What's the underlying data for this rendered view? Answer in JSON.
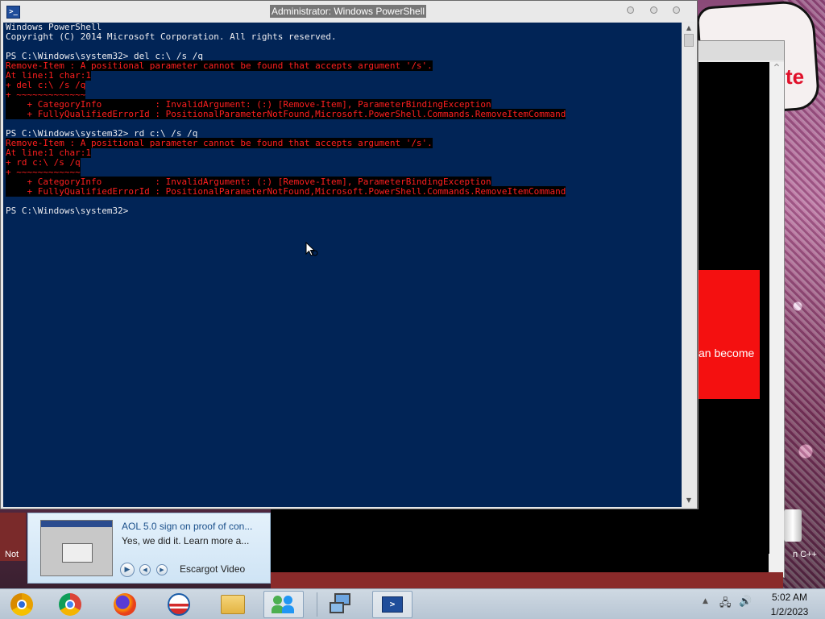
{
  "window": {
    "title": "Administrator: Windows PowerShell",
    "app_icon_glyph": ">_"
  },
  "console": {
    "lines": [
      {
        "text": "Windows PowerShell",
        "error": false
      },
      {
        "text": "Copyright (C) 2014 Microsoft Corporation. All rights reserved.",
        "error": false
      },
      {
        "text": "",
        "error": false
      },
      {
        "text": "PS C:\\Windows\\system32> del c:\\ /s /q",
        "error": false
      },
      {
        "text": "Remove-Item : A positional parameter cannot be found that accepts argument '/s'.",
        "error": true
      },
      {
        "text": "At line:1 char:1",
        "error": true
      },
      {
        "text": "+ del c:\\ /s /q",
        "error": true
      },
      {
        "text": "+ ~~~~~~~~~~~~~",
        "error": true
      },
      {
        "text": "    + CategoryInfo          : InvalidArgument: (:) [Remove-Item], ParameterBindingException",
        "error": true
      },
      {
        "text": "    + FullyQualifiedErrorId : PositionalParameterNotFound,Microsoft.PowerShell.Commands.RemoveItemCommand",
        "error": true
      },
      {
        "text": "",
        "error": false
      },
      {
        "text": "PS C:\\Windows\\system32> rd c:\\ /s /q",
        "error": false
      },
      {
        "text": "Remove-Item : A positional parameter cannot be found that accepts argument '/s'.",
        "error": true
      },
      {
        "text": "At line:1 char:1",
        "error": true
      },
      {
        "text": "+ rd c:\\ /s /q",
        "error": true
      },
      {
        "text": "+ ~~~~~~~~~~~~",
        "error": true
      },
      {
        "text": "    + CategoryInfo          : InvalidArgument: (:) [Remove-Item], ParameterBindingException",
        "error": true
      },
      {
        "text": "    + FullyQualifiedErrorId : PositionalParameterNotFound,Microsoft.PowerShell.Commands.RemoveItemCommand",
        "error": true
      },
      {
        "text": "",
        "error": false
      },
      {
        "text": "PS C:\\Windows\\system32> ",
        "error": false
      }
    ],
    "colors": {
      "background": "#012456",
      "foreground": "#eeedf0",
      "error": "#ff1f1f"
    }
  },
  "background_window": {
    "red_card_text": "an become",
    "corner_text": "n C++",
    "left_icon_label": "Not",
    "sticker_text": "te"
  },
  "notification": {
    "title": "AOL 5.0 sign on proof of con...",
    "description": "Yes, we did it. Learn more a...",
    "source": "Escargot Video"
  },
  "taskbar": {
    "items": [
      {
        "name": "taskbar-chrome-canary",
        "icon": "chrome-canary-icon",
        "active": false
      },
      {
        "name": "taskbar-chrome",
        "icon": "chrome-icon",
        "active": false
      },
      {
        "name": "taskbar-firefox",
        "icon": "firefox-icon",
        "active": false
      },
      {
        "name": "taskbar-obama-logo",
        "icon": "obama-logo-icon",
        "active": false
      },
      {
        "name": "taskbar-file-explorer",
        "icon": "folder-icon",
        "active": false
      },
      {
        "name": "taskbar-messenger",
        "icon": "messenger-people-icon",
        "active": true
      },
      {
        "name": "taskbar-remote-desktop",
        "icon": "remote-desktop-icon",
        "active": false
      },
      {
        "name": "taskbar-powershell",
        "icon": "powershell-icon",
        "active": true
      }
    ],
    "tray": {
      "chevron": "▲",
      "network": "🖧",
      "volume": "🔊"
    },
    "clock": {
      "time": "5:02 AM",
      "date": "1/2/2023"
    }
  }
}
